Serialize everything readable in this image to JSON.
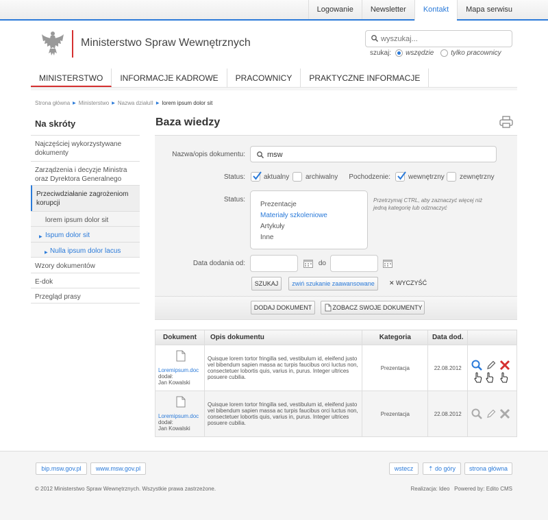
{
  "topnav": {
    "items": [
      "Logowanie",
      "Newsletter",
      "Kontakt",
      "Mapa serwisu"
    ],
    "active": "Kontakt"
  },
  "header": {
    "title": "Ministerstwo Spraw Wewnętrznych",
    "search_placeholder": "wyszukaj...",
    "scope_label": "szukaj:",
    "scope_options": [
      "wszędzie",
      "tylko pracownicy"
    ],
    "scope_selected": "wszędzie"
  },
  "mainnav": {
    "items": [
      "MINISTERSTWO",
      "INFORMACJE KADROWE",
      "PRACOWNICY",
      "PRAKTYCZNE INFORMACJE"
    ],
    "active": "MINISTERSTWO"
  },
  "breadcrumb": [
    "Strona główna",
    "Ministerstwo",
    "Nazwa działuII",
    "lorem ipsum dolor sit"
  ],
  "sidebar": {
    "title": "Na skróty",
    "items": [
      "Najczęściej wykorzystywane dokumenty",
      "Zarządzenia i decyzje Ministra oraz Dyrektora Generalnego",
      "Przeciwdziałanie zagrożeniom korupcji",
      "lorem ipsum dolor sit",
      "Ispum dolor sit",
      "Nulla ipsum dolor lacus",
      "Wzory dokumentów",
      "E-dok",
      "Przegląd prasy"
    ]
  },
  "page": {
    "title": "Baza wiedzy"
  },
  "form": {
    "doc_label": "Nazwa/opis dokumentu:",
    "doc_value": "msw",
    "status_label": "Status:",
    "status_options": [
      {
        "label": "aktualny",
        "checked": true
      },
      {
        "label": "archiwalny",
        "checked": false
      }
    ],
    "origin_label": "Pochodzenie:",
    "origin_options": [
      {
        "label": "wewnętrzny",
        "checked": true
      },
      {
        "label": "zewnętrzny",
        "checked": false
      }
    ],
    "category_label": "Status:",
    "categories": [
      "Prezentacje",
      "Materiały szkoleniowe",
      "Artykuły",
      "Inne"
    ],
    "category_selected": "Materiały szkoleniowe",
    "hint": "Przetrzymaj CTRL, aby zaznaczyć więcej niż jedną kategorię lub odznaczyć",
    "date_label": "Data dodania od:",
    "date_to_label": "do",
    "search_button": "SZUKAJ",
    "collapse_button": "zwiń szukanie zaawansowane",
    "clear_button": "WYCZYŚĆ",
    "add_button": "DODAJ DOKUMENT",
    "my_docs_button": "ZOBACZ SWOJE DOKUMENTY"
  },
  "table": {
    "headers": [
      "Dokument",
      "Opis dokumentu",
      "Kategoria",
      "Data dod.",
      ""
    ],
    "rows": [
      {
        "filename": "Loremipsum.doc",
        "added_label": "dodał:",
        "author": "Jan Kowalski",
        "description": "Quisque lorem tortor fringilla sed, vestibulum id, eleifend justo vel bibendum sapien massa ac turpis faucibus orci luctus non, consectetuer lobortis quis, varius in, purus. Integer ultrices posuere cubilia.",
        "category": "Prezentacja",
        "date": "22.08.2012"
      },
      {
        "filename": "Loremipsum.doc",
        "added_label": "dodał:",
        "author": "Jan Kowalski",
        "description": "Quisque lorem tortor fringilla sed, vestibulum id, eleifend justo vel bibendum sapien massa ac turpis faucibus orci luctus non, consectetuer lobortis quis, varius in, purus. Integer ultrices posuere cubilia.",
        "category": "Prezentacja",
        "date": "22.08.2012"
      }
    ]
  },
  "footer": {
    "links_left": [
      "bip.msw.gov.pl",
      "www.msw.gov.pl"
    ],
    "links_right": [
      "wstecz",
      "do góry",
      "strona główna"
    ],
    "copyright": "© 2012 Ministerstwo Spraw Wewnętrznych. Wszystkie prawa zastrzeżone.",
    "realization": "Realizacja: Ideo",
    "powered": "Powered by: Edito CMS"
  },
  "colors": {
    "accent": "#2a7ad9",
    "red": "#d53030"
  }
}
